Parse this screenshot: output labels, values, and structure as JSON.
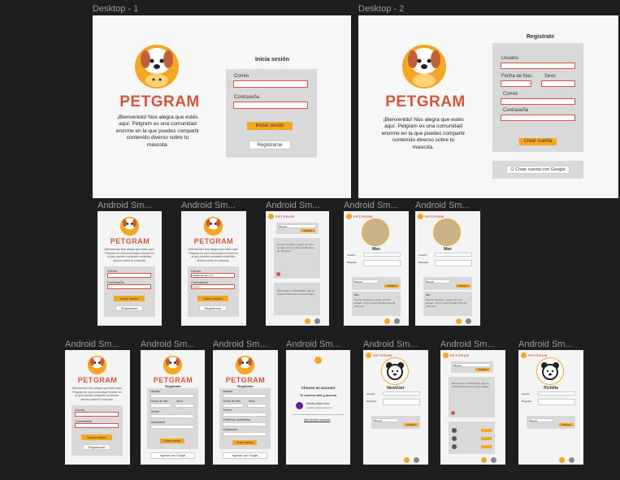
{
  "frames": {
    "desktop1": "Desktop - 1",
    "desktop2": "Desktop - 2",
    "android": "Android Sm..."
  },
  "brand": "PETGRAM",
  "brand_small": "PETGRAM",
  "welcome": "¡Bienvenido! Nos alegra que estés aquí. Petgram es una comunidad enorme en la que puedes compartir contenido diverso sobre tu mascota.",
  "login": {
    "title": "Inicia sesión",
    "email_label": "Correo",
    "password_label": "Contraseña",
    "login_button": "Iniciar sesión",
    "register_button": "Registrarse",
    "email_value": "mail@example.com",
    "password_value": "••••••••••"
  },
  "register": {
    "title": "Registrate",
    "user_label": "Usuario",
    "birth_label": "Fecha de Nac.",
    "sex_label": "Sexo",
    "email_label": "Correo",
    "password_label": "Contraseña",
    "confirm_label": "Confirmar contraseña",
    "create_button": "Crear cuenta",
    "google_button": "Crear cuenta con Google",
    "google_small": "Ingresar con Google"
  },
  "google_dialog": {
    "title": "Choose an account",
    "subtitle": "To continue with g account",
    "account_name": "Sandra María Mor.",
    "account_mail": "sandra.mm@gmail.com",
    "add": "Add another account"
  },
  "profiles": {
    "pet1": "Max",
    "pet2": "Max",
    "new_user": "NewUser",
    "pichiña": "Pichiña",
    "username_label": "Usuario",
    "bio_label": "Biografía",
    "search": "Buscar",
    "publish": "Publicar",
    "post_author": "Max",
    "post_text": "Hoy fui al parque y jugué con mis amigos. ¡Fue un día increíble lleno de diversión!",
    "post_text_2": "Bienvenidos a PETGRAM, aquí se inicia la historia de nuevos amigos"
  },
  "colors": {
    "brand": "#d4553a",
    "accent": "#f5a623",
    "panel": "#d9d9d9",
    "background": "#1e1e1e"
  }
}
